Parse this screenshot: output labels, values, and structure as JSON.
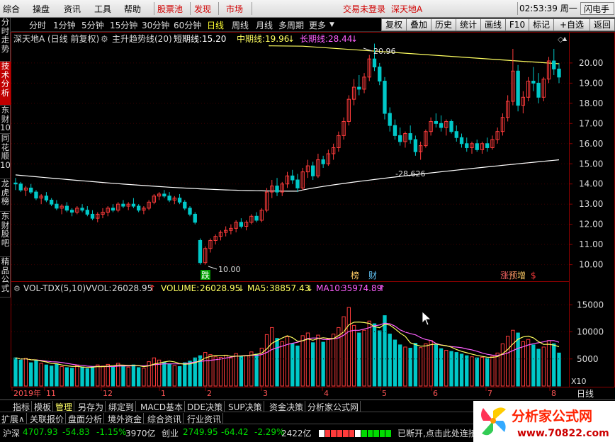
{
  "menu": {
    "items": [
      "综合",
      "操盘",
      "资讯",
      "工具",
      "帮助"
    ],
    "red_items": [
      "股票池",
      "发现",
      "市场"
    ],
    "status": "交易未登录",
    "stock": "深天地A",
    "time": "02:53:39",
    "weekday": "周一",
    "flash": "闪电手"
  },
  "left_tabs": [
    "分时走势",
    "技术分析",
    "东财10",
    "同花顺10",
    "龙虎榜",
    "东财股吧",
    "精品公式"
  ],
  "periods": [
    "分时",
    "1分钟",
    "5分钟",
    "15分钟",
    "30分钟",
    "60分钟",
    "日线",
    "周线",
    "月线",
    "多周期",
    "更多"
  ],
  "selected_period": "日线",
  "right_buttons": [
    "复权",
    "叠加",
    "历史",
    "统计",
    "画线",
    "F10",
    "标记",
    "+自选",
    "返回"
  ],
  "chart_header": {
    "name": "深天地A",
    "mode": "(日线 前复权)",
    "indicator": "主升趋势线(20)",
    "short_label": "短期线:",
    "short_value": "15.20",
    "mid_label": "中期线:",
    "mid_value": "19.96",
    "long_label": "长期线:",
    "long_value": "28.44"
  },
  "price_axis": [
    "20.00",
    "19.00",
    "18.00",
    "17.00",
    "16.00",
    "15.00",
    "14.00",
    "13.00",
    "12.00",
    "11.00",
    "10.00"
  ],
  "annotations": {
    "high": "20.96",
    "low": "10.00",
    "mid_low": "-28.626"
  },
  "markers": {
    "die": "跌",
    "bang": "榜",
    "cai": "财",
    "zhang": "涨",
    "yu": "预",
    "zeng": "增",
    "s": "$"
  },
  "vol_header": {
    "name": "VOL-TDX(5,10)",
    "vvol_label": "VVOL:",
    "vvol_value": "26028.95",
    "volume_label": "VOLUME:",
    "volume_value": "26028.95",
    "ma5_label": "MA5:",
    "ma5_value": "38857.43",
    "ma10_label": "MA10:",
    "ma10_value": "35974.89"
  },
  "vol_axis": [
    "15000",
    "10000",
    "5000"
  ],
  "vol_unit": "X10",
  "date_axis": [
    "2019年",
    "11",
    "12",
    "1",
    "2",
    "3",
    "4",
    "5",
    "6",
    "7",
    "8"
  ],
  "date_axis_right": "日线",
  "bottom_tabs": [
    "指标",
    "模板",
    "管理",
    "另存为",
    "绑定到",
    "MACD基本",
    "DDE决策",
    "SUP决策",
    "资金决策",
    "分析家公式网"
  ],
  "selected_bottom_tab": "管理",
  "panel_tabs": [
    "扩展∧",
    "关联报价",
    "盘面分析",
    "境外资金",
    "综合资讯",
    "行业资讯"
  ],
  "status": {
    "sh_label": "沪深",
    "sh_value": "4707.93",
    "sh_change": "-54.83",
    "sh_pct": "-1.15%",
    "sh_amount": "3970亿",
    "cy_label": "创业",
    "cy_value": "2749.95",
    "cy_change": "-64.42",
    "cy_pct": "-2.29%",
    "cy_amount": "2422亿",
    "msg": "已断开,点击此处连接"
  },
  "logo": {
    "text": "分析家公式网",
    "url": "www.70822.com"
  },
  "colors": {
    "up": "#ff3b3b",
    "down": "#00c8c8",
    "short": "#ffffff",
    "mid": "#ffff60",
    "long": "#ff60ff",
    "panel_border": "#8b0000"
  },
  "chart_data": {
    "type": "candlestick",
    "y_range": [
      9.6,
      21.05
    ],
    "volume_range": [
      0,
      17000
    ],
    "candles": [
      [
        14.05,
        14.3,
        13.7,
        14.0,
        5200
      ],
      [
        14.0,
        14.1,
        13.6,
        13.7,
        4800
      ],
      [
        13.7,
        13.9,
        13.4,
        13.8,
        5100
      ],
      [
        13.8,
        14.0,
        13.5,
        13.6,
        4300
      ],
      [
        13.6,
        13.7,
        13.2,
        13.3,
        4700
      ],
      [
        13.3,
        13.5,
        13.0,
        13.4,
        4200
      ],
      [
        13.4,
        13.6,
        13.1,
        13.2,
        3900
      ],
      [
        13.2,
        13.3,
        12.9,
        13.0,
        3700
      ],
      [
        13.0,
        13.2,
        12.7,
        12.8,
        4100
      ],
      [
        12.8,
        13.0,
        12.5,
        12.9,
        3600
      ],
      [
        12.9,
        13.1,
        12.6,
        12.7,
        3400
      ],
      [
        12.7,
        12.8,
        12.4,
        12.6,
        3300
      ],
      [
        12.6,
        12.9,
        12.5,
        12.8,
        3800
      ],
      [
        12.8,
        13.0,
        12.6,
        12.7,
        3500
      ],
      [
        12.7,
        12.9,
        12.4,
        12.5,
        3200
      ],
      [
        12.5,
        12.7,
        12.2,
        12.3,
        3600
      ],
      [
        12.3,
        12.6,
        12.1,
        12.5,
        3900
      ],
      [
        12.5,
        12.8,
        12.3,
        12.6,
        3700
      ],
      [
        12.6,
        12.9,
        12.4,
        12.8,
        4000
      ],
      [
        12.8,
        13.0,
        12.6,
        12.7,
        3600
      ],
      [
        12.7,
        13.1,
        12.6,
        13.0,
        4200
      ],
      [
        13.0,
        13.2,
        12.8,
        12.9,
        3800
      ],
      [
        12.9,
        13.1,
        12.7,
        13.0,
        3500
      ],
      [
        13.0,
        13.3,
        12.8,
        12.9,
        3900
      ],
      [
        12.9,
        13.0,
        12.6,
        12.7,
        3400
      ],
      [
        12.7,
        12.9,
        12.5,
        12.8,
        3300
      ],
      [
        12.8,
        13.2,
        12.7,
        13.1,
        4500
      ],
      [
        13.1,
        13.5,
        13.0,
        13.4,
        5200
      ],
      [
        13.4,
        13.6,
        13.2,
        13.5,
        4800
      ],
      [
        13.5,
        13.7,
        13.3,
        13.4,
        4400
      ],
      [
        13.4,
        13.6,
        13.1,
        13.2,
        4100
      ],
      [
        13.2,
        13.4,
        13.0,
        13.3,
        3800
      ],
      [
        13.3,
        13.5,
        13.0,
        13.1,
        3600
      ],
      [
        13.1,
        13.2,
        12.7,
        12.8,
        4300
      ],
      [
        12.8,
        12.9,
        12.4,
        12.5,
        4600
      ],
      [
        12.5,
        12.6,
        12.0,
        12.1,
        5200
      ],
      [
        11.2,
        11.3,
        10.0,
        10.1,
        5600
      ],
      [
        10.1,
        10.9,
        10.0,
        10.8,
        6200
      ],
      [
        10.8,
        11.3,
        10.6,
        11.2,
        5800
      ],
      [
        11.2,
        11.5,
        11.0,
        11.4,
        5400
      ],
      [
        11.4,
        11.7,
        11.2,
        11.6,
        5300
      ],
      [
        11.6,
        11.9,
        11.4,
        11.7,
        5700
      ],
      [
        11.7,
        12.0,
        11.5,
        11.8,
        5200
      ],
      [
        11.8,
        12.2,
        11.6,
        12.1,
        6000
      ],
      [
        12.1,
        12.3,
        11.8,
        11.9,
        5500
      ],
      [
        11.9,
        12.2,
        11.7,
        12.1,
        5600
      ],
      [
        12.1,
        12.5,
        12.0,
        12.4,
        6300
      ],
      [
        12.4,
        12.6,
        12.1,
        12.2,
        5900
      ],
      [
        12.2,
        12.8,
        12.1,
        12.7,
        7000
      ],
      [
        12.7,
        13.8,
        12.6,
        13.6,
        9500
      ],
      [
        13.6,
        14.2,
        13.3,
        13.9,
        10800
      ],
      [
        13.9,
        14.3,
        13.4,
        13.6,
        8800
      ],
      [
        13.6,
        14.1,
        13.4,
        14.0,
        8200
      ],
      [
        14.0,
        14.6,
        13.8,
        14.4,
        9100
      ],
      [
        14.4,
        14.7,
        14.0,
        14.2,
        7800
      ],
      [
        14.2,
        14.5,
        13.6,
        13.8,
        7400
      ],
      [
        13.8,
        14.8,
        13.7,
        14.6,
        9300
      ],
      [
        14.6,
        15.2,
        14.3,
        14.9,
        9800
      ],
      [
        14.9,
        15.1,
        14.2,
        14.4,
        8000
      ],
      [
        14.4,
        15.5,
        14.3,
        15.2,
        9400
      ],
      [
        15.2,
        15.4,
        14.8,
        15.0,
        8100
      ],
      [
        15.0,
        15.7,
        14.9,
        15.5,
        8700
      ],
      [
        15.5,
        16.0,
        15.2,
        15.8,
        9600
      ],
      [
        15.8,
        16.6,
        15.6,
        16.4,
        10800
      ],
      [
        16.4,
        17.3,
        16.2,
        17.1,
        12800
      ],
      [
        17.1,
        18.4,
        16.9,
        18.2,
        14500
      ],
      [
        18.2,
        19.2,
        17.9,
        18.8,
        11200
      ],
      [
        18.8,
        19.4,
        18.4,
        18.7,
        9800
      ],
      [
        18.7,
        19.5,
        18.5,
        19.3,
        10300
      ],
      [
        19.3,
        20.4,
        19.1,
        20.2,
        12000
      ],
      [
        20.2,
        20.96,
        19.6,
        19.8,
        11500
      ],
      [
        19.8,
        20.0,
        18.9,
        19.1,
        10200
      ],
      [
        19.1,
        19.3,
        17.2,
        17.5,
        13000
      ],
      [
        17.5,
        17.8,
        16.6,
        16.9,
        9600
      ],
      [
        16.9,
        17.2,
        16.2,
        16.4,
        8500
      ],
      [
        16.4,
        16.8,
        15.9,
        16.1,
        7600
      ],
      [
        16.1,
        16.6,
        15.8,
        16.5,
        7200
      ],
      [
        16.5,
        16.9,
        16.0,
        16.2,
        7000
      ],
      [
        16.2,
        16.4,
        15.4,
        15.6,
        7900
      ],
      [
        15.6,
        16.1,
        15.2,
        15.9,
        7100
      ],
      [
        15.9,
        16.7,
        15.8,
        16.6,
        7800
      ],
      [
        16.6,
        17.3,
        16.4,
        17.1,
        8400
      ],
      [
        17.1,
        17.5,
        16.8,
        17.0,
        7600
      ],
      [
        17.0,
        17.4,
        16.6,
        16.8,
        6900
      ],
      [
        16.8,
        17.2,
        16.4,
        17.1,
        6600
      ],
      [
        17.1,
        17.2,
        16.5,
        16.6,
        6400
      ],
      [
        16.6,
        16.9,
        16.1,
        16.3,
        6200
      ],
      [
        16.3,
        16.5,
        15.8,
        16.0,
        5900
      ],
      [
        16.0,
        16.3,
        15.6,
        15.8,
        5600
      ],
      [
        15.8,
        16.1,
        15.5,
        16.0,
        5400
      ],
      [
        16.0,
        16.2,
        15.6,
        15.7,
        5200
      ],
      [
        15.7,
        16.1,
        15.5,
        16.0,
        5300
      ],
      [
        16.0,
        16.3,
        15.6,
        15.8,
        5100
      ],
      [
        15.8,
        16.4,
        15.7,
        16.2,
        5500
      ],
      [
        16.2,
        16.8,
        16.0,
        16.6,
        6100
      ],
      [
        16.6,
        17.5,
        16.4,
        17.3,
        7800
      ],
      [
        17.3,
        18.4,
        17.1,
        18.1,
        9200
      ],
      [
        18.1,
        20.7,
        17.9,
        19.6,
        10300
      ],
      [
        19.6,
        19.9,
        17.6,
        17.9,
        9800
      ],
      [
        17.9,
        18.6,
        17.5,
        18.3,
        8200
      ],
      [
        18.3,
        19.3,
        18.1,
        19.1,
        8600
      ],
      [
        19.1,
        19.8,
        18.6,
        19.0,
        7600
      ],
      [
        19.0,
        19.5,
        18.0,
        18.3,
        6800
      ],
      [
        18.3,
        19.3,
        18.1,
        19.2,
        7200
      ],
      [
        19.2,
        20.3,
        19.0,
        20.1,
        8400
      ],
      [
        20.1,
        20.7,
        19.4,
        19.7,
        7800
      ],
      [
        19.7,
        20.0,
        19.0,
        19.3,
        6100
      ]
    ],
    "short_line": [
      14.6,
      15.2
    ],
    "mid_line": [
      20.85,
      19.96
    ],
    "long_line": [
      14.45,
      15.2
    ]
  }
}
